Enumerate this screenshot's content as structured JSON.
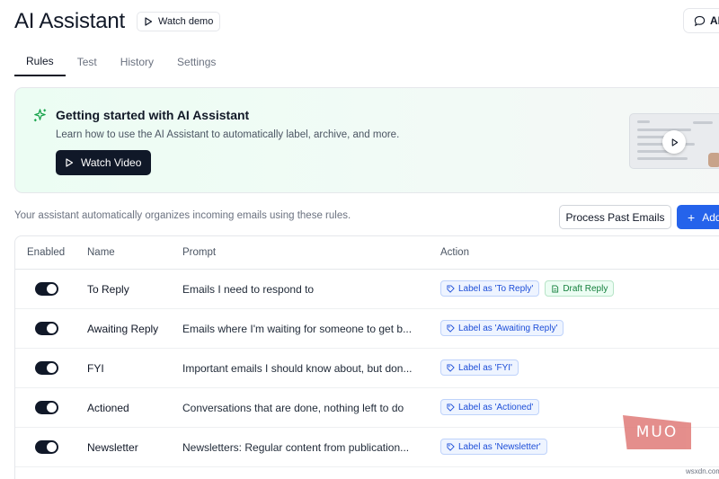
{
  "header": {
    "title": "AI Assistant",
    "watch_demo_label": "Watch demo",
    "ai_chat_label": "AI"
  },
  "tabs": [
    {
      "label": "Rules",
      "active": true
    },
    {
      "label": "Test",
      "active": false
    },
    {
      "label": "History",
      "active": false
    },
    {
      "label": "Settings",
      "active": false
    }
  ],
  "banner": {
    "title": "Getting started with AI Assistant",
    "description": "Learn how to use the AI Assistant to automatically label, archive, and more.",
    "button_label": "Watch Video",
    "icon": "sparkle-icon"
  },
  "info_text": "Your assistant automatically organizes incoming emails using these rules.",
  "actions": {
    "process_label": "Process Past Emails",
    "add_label": "Add"
  },
  "table": {
    "headers": [
      "Enabled",
      "Name",
      "Prompt",
      "Action"
    ],
    "rows": [
      {
        "enabled": true,
        "name": "To Reply",
        "prompt": "Emails I need to respond to",
        "badges": [
          {
            "type": "label",
            "text": "Label as 'To Reply'"
          },
          {
            "type": "draft",
            "text": "Draft Reply"
          }
        ]
      },
      {
        "enabled": true,
        "name": "Awaiting Reply",
        "prompt": "Emails where I'm waiting for someone to get b...",
        "badges": [
          {
            "type": "label",
            "text": "Label as 'Awaiting Reply'"
          }
        ]
      },
      {
        "enabled": true,
        "name": "FYI",
        "prompt": "Important emails I should know about, but don...",
        "badges": [
          {
            "type": "label",
            "text": "Label as 'FYI'"
          }
        ]
      },
      {
        "enabled": true,
        "name": "Actioned",
        "prompt": "Conversations that are done, nothing left to do",
        "badges": [
          {
            "type": "label",
            "text": "Label as 'Actioned'"
          }
        ]
      },
      {
        "enabled": true,
        "name": "Newsletter",
        "prompt": "Newsletters: Regular content from publication...",
        "badges": [
          {
            "type": "label",
            "text": "Label as 'Newsletter'"
          }
        ]
      }
    ]
  },
  "watermark": {
    "logo": "MUO",
    "site": "wsxdn.com"
  },
  "colors": {
    "primary": "#2563eb",
    "dark": "#101828",
    "label_badge": "#1d4ed8",
    "draft_badge": "#15803d",
    "banner_green": "#ecfdf3"
  }
}
